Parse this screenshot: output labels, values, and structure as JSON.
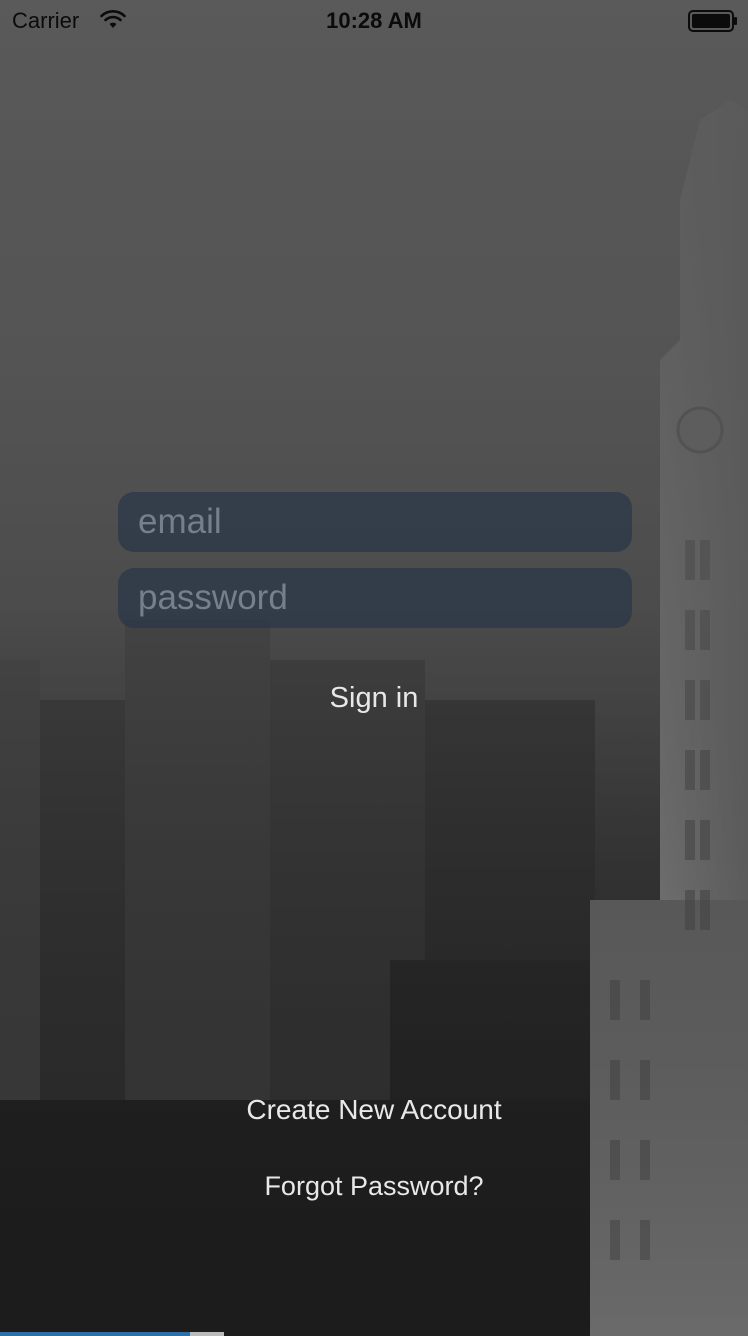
{
  "status_bar": {
    "carrier": "Carrier",
    "time": "10:28 AM",
    "wifi_icon": "wifi-icon",
    "battery_icon": "battery-icon"
  },
  "login_form": {
    "email_placeholder": "email",
    "email_value": "",
    "password_placeholder": "password",
    "password_value": "",
    "sign_in_label": "Sign in"
  },
  "links": {
    "create_account_label": "Create New Account",
    "forgot_password_label": "Forgot Password?"
  },
  "colors": {
    "field_background": "#283748",
    "button_text": "#e8e8e8"
  }
}
